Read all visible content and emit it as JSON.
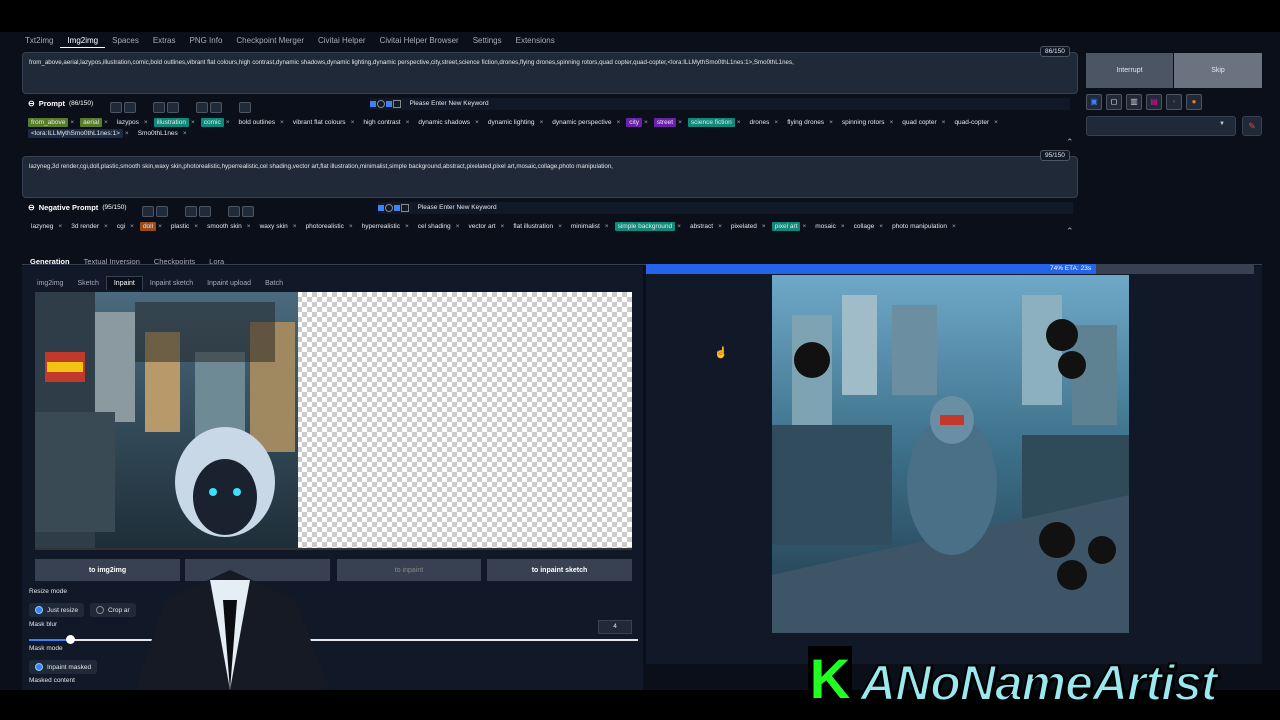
{
  "tabs": [
    "Txt2img",
    "Img2img",
    "Spaces",
    "Extras",
    "PNG Info",
    "Checkpoint Merger",
    "Civitai Helper",
    "Civitai Helper Browser",
    "Settings",
    "Extensions"
  ],
  "prompt": {
    "text": "from_above,aerial,lazypos,illustration,comic,bold outlines,vibrant flat colours,high contrast,dynamic shadows,dynamic lighting,dynamic perspective,city,street,science fiction,drones,flying drones,spinning rotors,quad copter,quad-copter,<lora:ILLMythSmo0thL1nes:1>,Smo0thL1nes,",
    "counter": "86/150",
    "label": "Prompt",
    "label_count": "(86/150)",
    "keyword_placeholder": "Please Enter New Keyword",
    "keywords": [
      {
        "t": "from_above",
        "c": "#5a7d2a"
      },
      {
        "t": "aerial",
        "c": "#5a7d2a"
      },
      {
        "t": "lazypos",
        "c": ""
      },
      {
        "t": "illustration",
        "c": "#0f8a7a"
      },
      {
        "t": "comic",
        "c": "#0f8a7a"
      },
      {
        "t": "bold outlines",
        "c": ""
      },
      {
        "t": "vibrant flat colours",
        "c": ""
      },
      {
        "t": "high contrast",
        "c": ""
      },
      {
        "t": "dynamic shadows",
        "c": ""
      },
      {
        "t": "dynamic lighting",
        "c": ""
      },
      {
        "t": "dynamic perspective",
        "c": ""
      },
      {
        "t": "city",
        "c": "#6b21a8"
      },
      {
        "t": "street",
        "c": "#6b21a8"
      },
      {
        "t": "science fiction",
        "c": "#0f8a7a"
      },
      {
        "t": "drones",
        "c": ""
      },
      {
        "t": "flying drones",
        "c": ""
      },
      {
        "t": "spinning rotors",
        "c": ""
      },
      {
        "t": "quad copter",
        "c": ""
      },
      {
        "t": "quad-copter",
        "c": ""
      },
      {
        "t": "<lora:ILLMythSmo0thL1nes:1>",
        "c": "#1e2a44"
      },
      {
        "t": "Smo0thL1nes",
        "c": ""
      }
    ]
  },
  "negative": {
    "text": "lazyneg,3d render,cgi,doll,plastic,smooth skin,waxy skin,photorealistic,hyperrealistic,cel shading,vector art,flat illustration,minimalist,simple background,abstract,pixelated,pixel art,mosaic,collage,photo manipulation,",
    "counter": "95/150",
    "label": "Negative Prompt",
    "label_count": "(95/150)",
    "keyword_placeholder": "Please Enter New Keyword",
    "keywords": [
      {
        "t": "lazyneg",
        "c": ""
      },
      {
        "t": "3d render",
        "c": ""
      },
      {
        "t": "cgi",
        "c": ""
      },
      {
        "t": "doll",
        "c": "#9a4b1a"
      },
      {
        "t": "plastic",
        "c": ""
      },
      {
        "t": "smooth skin",
        "c": ""
      },
      {
        "t": "waxy skin",
        "c": ""
      },
      {
        "t": "photorealistic",
        "c": ""
      },
      {
        "t": "hyperrealistic",
        "c": ""
      },
      {
        "t": "cel shading",
        "c": ""
      },
      {
        "t": "vector art",
        "c": ""
      },
      {
        "t": "flat illustration",
        "c": ""
      },
      {
        "t": "minimalist",
        "c": ""
      },
      {
        "t": "simple background",
        "c": "#0f8a7a"
      },
      {
        "t": "abstract",
        "c": ""
      },
      {
        "t": "pixelated",
        "c": ""
      },
      {
        "t": "pixel art",
        "c": "#0f8a7a"
      },
      {
        "t": "mosaic",
        "c": ""
      },
      {
        "t": "collage",
        "c": ""
      },
      {
        "t": "photo manipulation",
        "c": ""
      }
    ]
  },
  "side": {
    "interrupt": "Interrupt",
    "skip": "Skip"
  },
  "main_tabs": [
    "Generation",
    "Textual Inversion",
    "Checkpoints",
    "Lora"
  ],
  "sub_tabs": [
    "img2img",
    "Sketch",
    "Inpaint",
    "Inpaint sketch",
    "Inpaint upload",
    "Batch"
  ],
  "buttons": {
    "to_img2img": "to img2img",
    "to_inpaint": "to inpaint",
    "to_inpaint_sketch": "to inpaint sketch"
  },
  "resize_mode": {
    "label": "Resize mode",
    "opt1": "Just resize",
    "opt2": "Crop ar"
  },
  "mask_blur": {
    "label": "Mask blur",
    "value": "4"
  },
  "mask_mode": {
    "label": "Mask mode",
    "opt1": "Inpaint masked"
  },
  "masked_content": {
    "label": "Masked content"
  },
  "progress": {
    "text": "74% ETA: 23s",
    "fraction": 0.74
  },
  "watermark": {
    "letter": "K",
    "name": "ANoNameArtist"
  }
}
